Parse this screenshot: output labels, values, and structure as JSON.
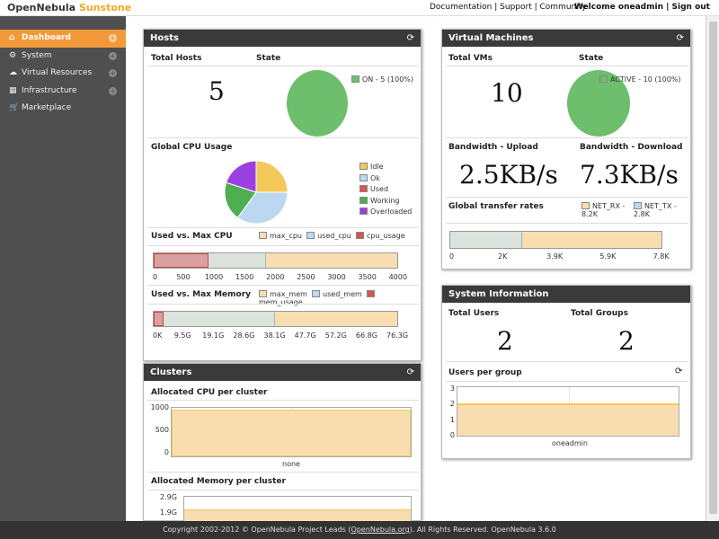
{
  "app": {
    "name": "OpenNebula",
    "name_accent": "Sunstone"
  },
  "toplinks": {
    "documentation": "Documentation",
    "support": "Support",
    "community": "Community"
  },
  "user": {
    "welcome": "Welcome oneadmin",
    "signout": "Sign out"
  },
  "sidebar": {
    "items": [
      {
        "label": "Dashboard",
        "icon": "home-icon",
        "active": true
      },
      {
        "label": "System",
        "icon": "gears-icon"
      },
      {
        "label": "Virtual Resources",
        "icon": "cloud-icon"
      },
      {
        "label": "Infrastructure",
        "icon": "sitemap-icon"
      },
      {
        "label": "Marketplace",
        "icon": "cart-icon"
      }
    ]
  },
  "hosts": {
    "title": "Hosts",
    "total_label": "Total Hosts",
    "total": "5",
    "state_label": "State",
    "state_legend": "ON - 5 (100%)",
    "cpu_usage_title": "Global CPU Usage",
    "cpu_legend": [
      "Idle",
      "Ok",
      "Used",
      "Working",
      "Overloaded"
    ],
    "used_vs_max_cpu": "Used vs. Max CPU",
    "cpu_bar_legend": [
      "max_cpu",
      "used_cpu",
      "cpu_usage"
    ],
    "cpu_ticks": [
      "0",
      "500",
      "1000",
      "1500",
      "2000",
      "2500",
      "3000",
      "3500",
      "4000"
    ],
    "used_vs_max_mem": "Used vs. Max Memory",
    "mem_bar_legend": [
      "max_mem",
      "used_mem",
      "mem_usage"
    ],
    "mem_ticks": [
      "0K",
      "9.5G",
      "19.1G",
      "28.6G",
      "38.1G",
      "47.7G",
      "57.2G",
      "66.8G",
      "76.3G"
    ]
  },
  "vms": {
    "title": "Virtual Machines",
    "total_label": "Total VMs",
    "total": "10",
    "state_label": "State",
    "state_legend": "ACTIVE - 10 (100%)",
    "bw_up_label": "Bandwidth - Upload",
    "bw_up": "2.5KB/s",
    "bw_down_label": "Bandwidth - Download",
    "bw_down": "7.3KB/s",
    "transfer_title": "Global transfer rates",
    "transfer_legend": [
      "NET_RX - 8.2K",
      "NET_TX - 2.8K"
    ],
    "transfer_ticks": [
      "0",
      "2K",
      "3.9K",
      "5.9K",
      "7.8K"
    ]
  },
  "sysinfo": {
    "title": "System Information",
    "users_label": "Total Users",
    "users": "2",
    "groups_label": "Total Groups",
    "groups": "2",
    "upg_title": "Users per group",
    "upg_yticks": [
      "3",
      "2",
      "1",
      "0"
    ],
    "upg_category": "oneadmin"
  },
  "clusters": {
    "title": "Clusters",
    "cpu_title": "Allocated CPU per cluster",
    "cpu_yticks": [
      "1000",
      "500",
      "0"
    ],
    "cpu_category": "none",
    "mem_title": "Allocated Memory per cluster",
    "mem_yticks": [
      "2.9G",
      "1.9G"
    ]
  },
  "footer": {
    "prefix": "Copyright 2002-2012 © OpenNebula Project Leads (",
    "link": "OpenNebula.org",
    "suffix": "). All Rights Reserved. OpenNebula 3.6.0"
  },
  "colors": {
    "green": "#6dbf6d",
    "yellow": "#f7ddb0",
    "blue": "#bcd8f1",
    "red": "#d9534f",
    "orange": "#f29a3b",
    "purple": "#9b3fe0"
  },
  "chart_data": [
    {
      "type": "pie",
      "title": "Global CPU Usage",
      "categories": [
        "Idle",
        "Ok",
        "Used",
        "Working",
        "Overloaded"
      ],
      "values": [
        25,
        35,
        0,
        20,
        20
      ]
    },
    {
      "type": "pie",
      "title": "Hosts State",
      "categories": [
        "ON"
      ],
      "values": [
        5
      ]
    },
    {
      "type": "pie",
      "title": "VM State",
      "categories": [
        "ACTIVE"
      ],
      "values": [
        10
      ]
    },
    {
      "type": "bar",
      "title": "Used vs. Max CPU",
      "series": [
        {
          "name": "max_cpu",
          "values": [
            4000
          ]
        },
        {
          "name": "used_cpu",
          "values": [
            1850
          ]
        },
        {
          "name": "cpu_usage",
          "values": [
            900
          ]
        }
      ],
      "xlim": [
        0,
        4000
      ]
    },
    {
      "type": "bar",
      "title": "Used vs. Max Memory",
      "series": [
        {
          "name": "max_mem",
          "values": [
            76.3
          ]
        },
        {
          "name": "used_mem",
          "values": [
            38
          ]
        },
        {
          "name": "mem_usage",
          "values": [
            3
          ]
        }
      ],
      "xlim": [
        0,
        76.3
      ]
    },
    {
      "type": "bar",
      "title": "Global transfer rates",
      "series": [
        {
          "name": "NET_RX",
          "values": [
            8.2
          ]
        },
        {
          "name": "NET_TX",
          "values": [
            2.8
          ]
        }
      ],
      "xlim": [
        0,
        8.2
      ]
    },
    {
      "type": "bar",
      "title": "Users per group",
      "categories": [
        "oneadmin"
      ],
      "values": [
        2
      ],
      "ylim": [
        0,
        3
      ]
    },
    {
      "type": "bar",
      "title": "Allocated CPU per cluster",
      "categories": [
        "none"
      ],
      "values": [
        1000
      ],
      "ylim": [
        0,
        1000
      ]
    }
  ]
}
